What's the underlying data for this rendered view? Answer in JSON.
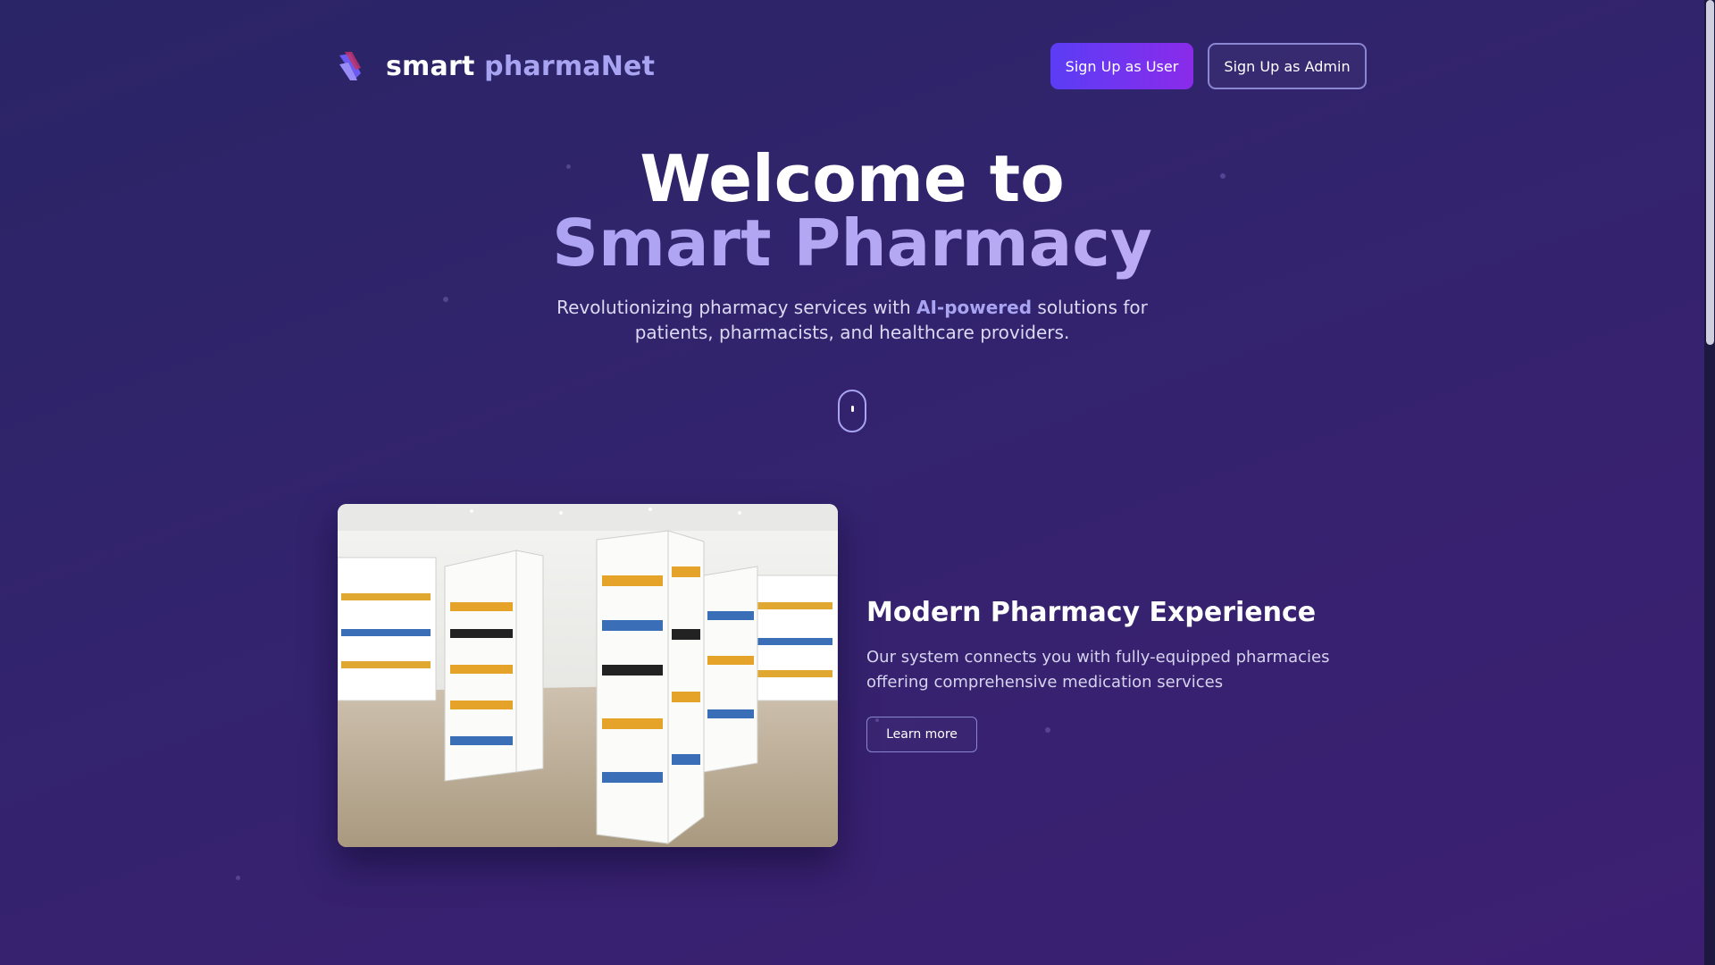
{
  "brand": {
    "word1": "smart",
    "word2": "pharmaNet",
    "logo_icon": "stacked-arrows-logo-icon"
  },
  "nav": {
    "signup_user": "Sign Up as User",
    "signup_admin": "Sign Up as Admin"
  },
  "hero": {
    "line1": "Welcome to",
    "line2": "Smart Pharmacy",
    "sub_before": "Revolutionizing pharmacy services with ",
    "sub_highlight": "AI-powered",
    "sub_after": " solutions for patients, pharmacists, and healthcare providers.",
    "scroll_icon": "mouse-scroll-icon"
  },
  "feature": {
    "image_icon": "pharmacy-interior-image",
    "title": "Modern Pharmacy Experience",
    "description": "Our system connects you with fully-equipped pharmacies offering comprehensive medication services",
    "cta": "Learn more"
  },
  "colors": {
    "accent": "#a8a4f2",
    "button_start": "#5b3df5",
    "button_end": "#8a2bea",
    "bg": "#2f2469"
  }
}
